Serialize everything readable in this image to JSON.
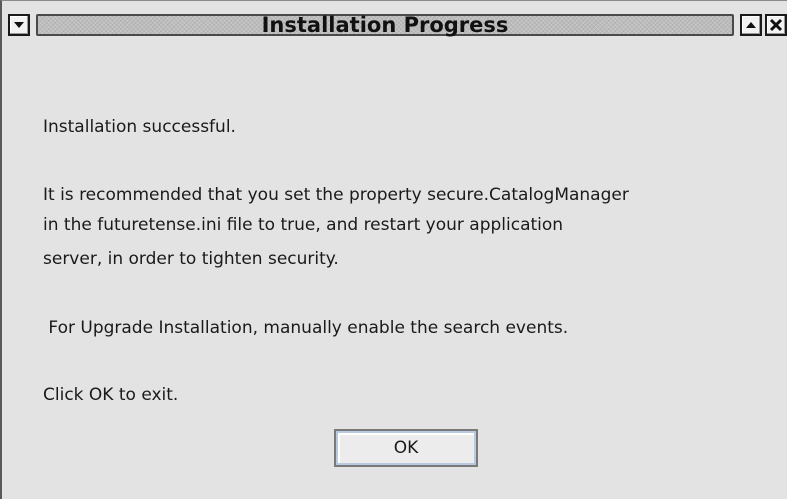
{
  "window": {
    "title": "Installation Progress"
  },
  "title_buttons": {
    "menu_icon": "chevron-down-icon",
    "maximize_icon": "chevron-up-icon",
    "close_icon": "close-icon"
  },
  "message": {
    "line1": "Installation successful.",
    "line2": "It is recommended that you set the property secure.CatalogManager",
    "line3": "in the futuretense.ini file to true, and restart your application",
    "line4": "server, in order to tighten security.",
    "line5": " For Upgrade Installation, manually enable the search events.",
    "line6": "Click OK to exit."
  },
  "buttons": {
    "ok_label": "OK"
  }
}
